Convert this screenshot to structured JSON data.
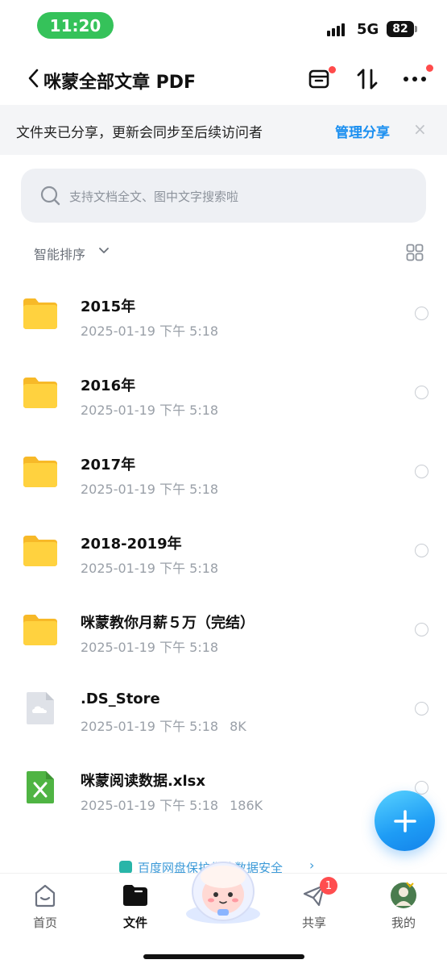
{
  "status_bar": {
    "time": "11:20",
    "network": "5G",
    "battery": "82"
  },
  "header": {
    "title": "咪蒙全部文章 PDF"
  },
  "share_banner": {
    "text": "文件夹已分享，更新会同步至后续访问者",
    "action": "管理分享",
    "close": "×"
  },
  "search": {
    "placeholder": "支持文档全文、图中文字搜索啦"
  },
  "sort": {
    "label": "智能排序"
  },
  "files": [
    {
      "name": "2015年",
      "date": "2025-01-19 下午 5:18",
      "size": "",
      "type": "folder",
      "icon": "folder-icon"
    },
    {
      "name": "2016年",
      "date": "2025-01-19 下午 5:18",
      "size": "",
      "type": "folder",
      "icon": "folder-icon"
    },
    {
      "name": "2017年",
      "date": "2025-01-19 下午 5:18",
      "size": "",
      "type": "folder",
      "icon": "folder-icon"
    },
    {
      "name": "2018-2019年",
      "date": "2025-01-19 下午 5:18",
      "size": "",
      "type": "folder",
      "icon": "folder-icon"
    },
    {
      "name": "咪蒙教你月薪５万（完结）",
      "date": "2025-01-19 下午 5:18",
      "size": "",
      "type": "folder",
      "icon": "folder-icon"
    },
    {
      "name": ".DS_Store",
      "date": "2025-01-19 下午 5:18",
      "size": "8K",
      "type": "file",
      "icon": "cloud-file-icon"
    },
    {
      "name": "咪蒙阅读数据.xlsx",
      "date": "2025-01-19 下午 5:18",
      "size": "186K",
      "type": "excel",
      "icon": "excel-file-icon"
    }
  ],
  "safety_banner": {
    "text": "百度网盘保护你的数据安全"
  },
  "tabs": [
    {
      "label": "首页",
      "icon": "home-icon",
      "active": false
    },
    {
      "label": "文件",
      "icon": "folder-tab-icon",
      "active": true
    },
    {
      "label": "共享",
      "icon": "send-icon",
      "active": false,
      "badge": "1"
    },
    {
      "label": "我的",
      "icon": "avatar-icon",
      "active": false
    }
  ],
  "colors": {
    "accent": "#1b8ff0",
    "folder": "#ffcf3a",
    "status_pill": "#35c25a",
    "badge": "#ff4d4f"
  }
}
